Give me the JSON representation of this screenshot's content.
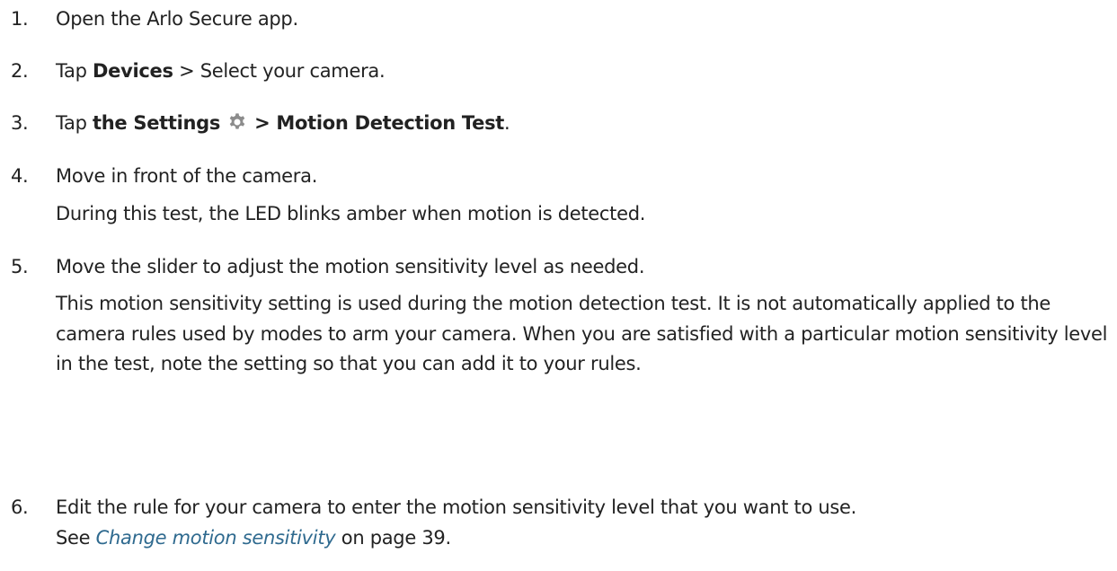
{
  "steps": [
    {
      "number": "1.",
      "text": "Open the Arlo Secure app."
    },
    {
      "number": "2.",
      "prefix": "Tap ",
      "bold": "Devices",
      "suffix": " > Select your camera."
    },
    {
      "number": "3.",
      "prefix": "Tap ",
      "bold_a": "the Settings",
      "icon": "gear-icon",
      "bold_b": "> Motion Detection Test",
      "suffix": "."
    },
    {
      "number": "4.",
      "text": "Move in front of the camera.",
      "note": "During this  test, the LED blinks amber when motion is detected."
    },
    {
      "number": "5.",
      "text": "Move the slider to adjust the motion sensitivity level as needed.",
      "note": "This motion sensitivity setting is used during the motion detection test. It is not automatically applied to the camera rules used by modes to arm your camera. When you are satisfied with a particular motion sensitivity level in the test, note the setting so that you can add it to your rules."
    },
    {
      "number": "6.",
      "text": "Edit the rule for your camera to enter the motion sensitivity level that you want to use.",
      "see_prefix": "See ",
      "link": "Change motion sensitivity",
      "see_suffix": " on page 39."
    }
  ],
  "colors": {
    "text": "#222222",
    "link": "#2f6a8f",
    "icon": "#8c8c8c"
  }
}
